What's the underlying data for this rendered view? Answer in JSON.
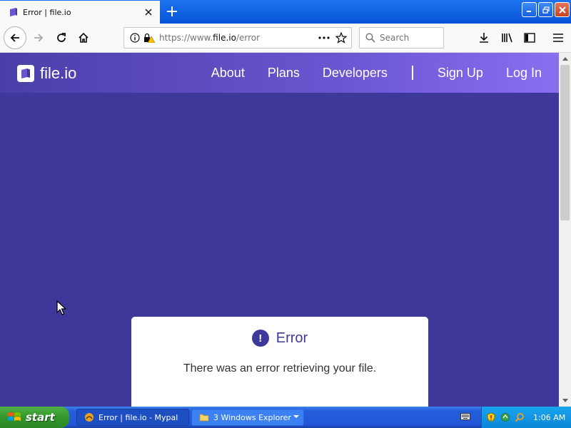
{
  "browser": {
    "tab_title": "Error | file.io",
    "url_prefix": "https://www.",
    "url_domain": "file.io",
    "url_path": "/error",
    "search_placeholder": "Search"
  },
  "site": {
    "logo_text": "file.io",
    "nav": {
      "about": "About",
      "plans": "Plans",
      "developers": "Developers",
      "signup": "Sign Up",
      "login": "Log In"
    },
    "error": {
      "icon_glyph": "!",
      "title": "Error",
      "message": "There was an error retrieving your file."
    },
    "colors": {
      "page_bg": "#3d3899",
      "accent": "#3d3899"
    }
  },
  "taskbar": {
    "start_label": "start",
    "tasks": [
      {
        "label": "Error | file.io - Mypal",
        "icon": "mypal-icon"
      },
      {
        "label": "3 Windows Explorer",
        "icon": "folder-icon"
      }
    ],
    "clock": "1:06 AM"
  }
}
